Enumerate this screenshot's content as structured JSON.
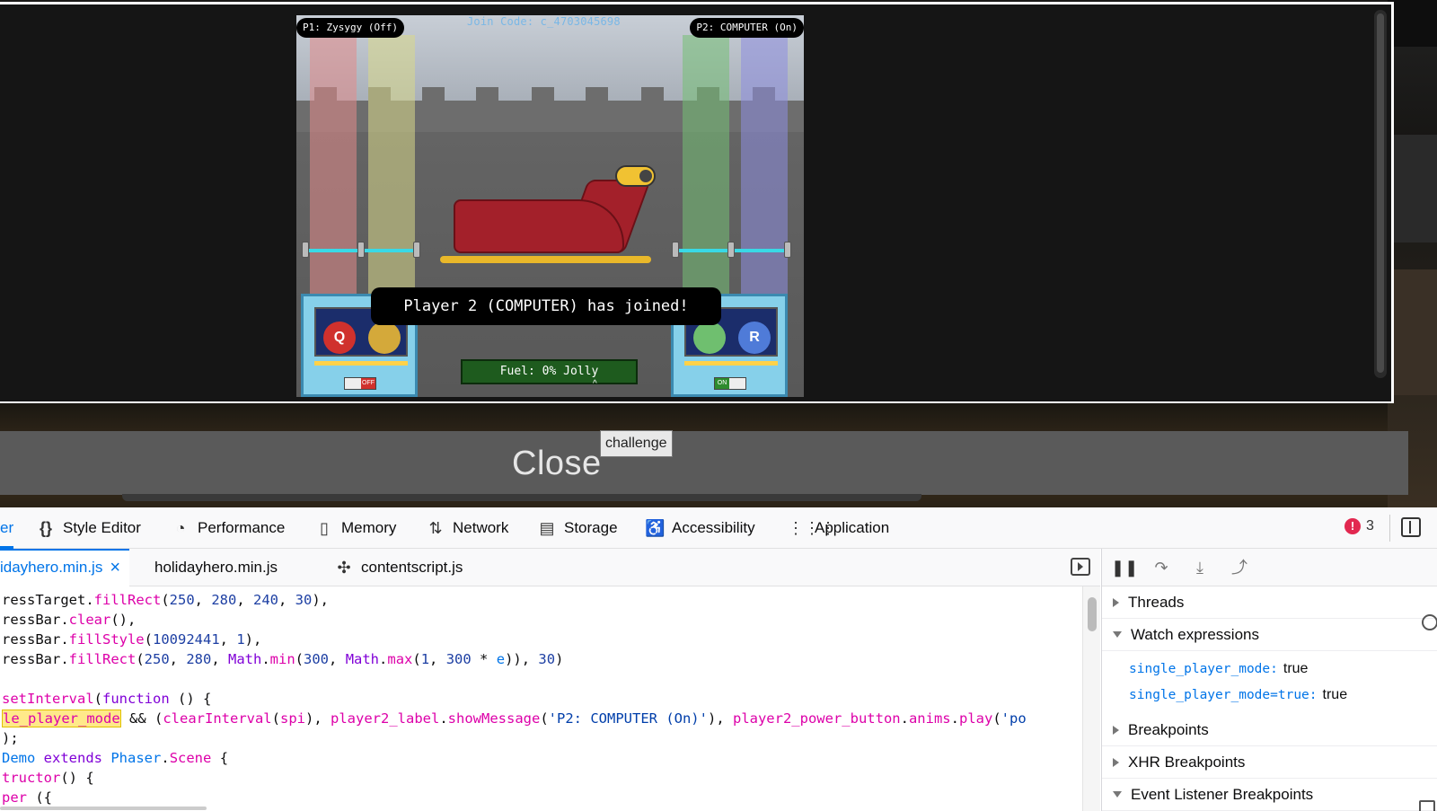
{
  "game": {
    "p1_label": "P1: Zysygy (Off)",
    "p2_label": "P2: COMPUTER (On)",
    "join_code": "Join Code: c_4703045698",
    "toast": "Player 2 (COMPUTER) has joined!",
    "fuel": "Fuel: 0% Jolly",
    "left_key": "Q",
    "right_key": "R",
    "left_switch": "OFF",
    "right_switch": "ON"
  },
  "overlay": {
    "close_label": "Close",
    "tooltip": "challenge"
  },
  "devtools": {
    "tabs": [
      {
        "label": "er",
        "icon": "debugger-icon"
      },
      {
        "label": "Style Editor",
        "icon": "braces-icon"
      },
      {
        "label": "Performance",
        "icon": "gauge-icon"
      },
      {
        "label": "Memory",
        "icon": "chip-icon"
      },
      {
        "label": "Network",
        "icon": "up-down-arrows-icon"
      },
      {
        "label": "Storage",
        "icon": "storage-icon"
      },
      {
        "label": "Accessibility",
        "icon": "accessibility-icon"
      },
      {
        "label": "Application",
        "icon": "grid-icon"
      }
    ],
    "error_count": "3",
    "source_tabs": [
      {
        "label": "idayhero.min.js"
      },
      {
        "label": "holidayhero.min.js"
      },
      {
        "label": "contentscript.js"
      }
    ],
    "code_lines": [
      "ressTarget.fillRect(250, 280, 240, 30),",
      "ressBar.clear(),",
      "ressBar.fillStyle(10092441, 1),",
      "ressBar.fillRect(250, 280, Math.min(300, Math.max(1, 300 * e)), 30)",
      "",
      "setInterval(function () {",
      "le_player_mode && (clearInterval(spi), player2_label.showMessage('P2: COMPUTER (On)'), player2_power_button.anims.play('po",
      ");",
      "Demo extends Phaser.Scene {",
      "tructor() {",
      "per ({"
    ],
    "sidebar": {
      "threads": "Threads",
      "watch": "Watch expressions",
      "watches": [
        {
          "expr": "single_player_mode:",
          "value": "true"
        },
        {
          "expr": "single_player_mode=true:",
          "value": "true"
        }
      ],
      "breakpoints": "Breakpoints",
      "xhr": "XHR Breakpoints",
      "event": "Event Listener Breakpoints"
    }
  },
  "colors": {
    "accent": "#0074e8",
    "error": "#e22850",
    "highlight": "#ffe98a",
    "fuel_bar": "#1e5b1e",
    "rail": "#39d9e6"
  }
}
